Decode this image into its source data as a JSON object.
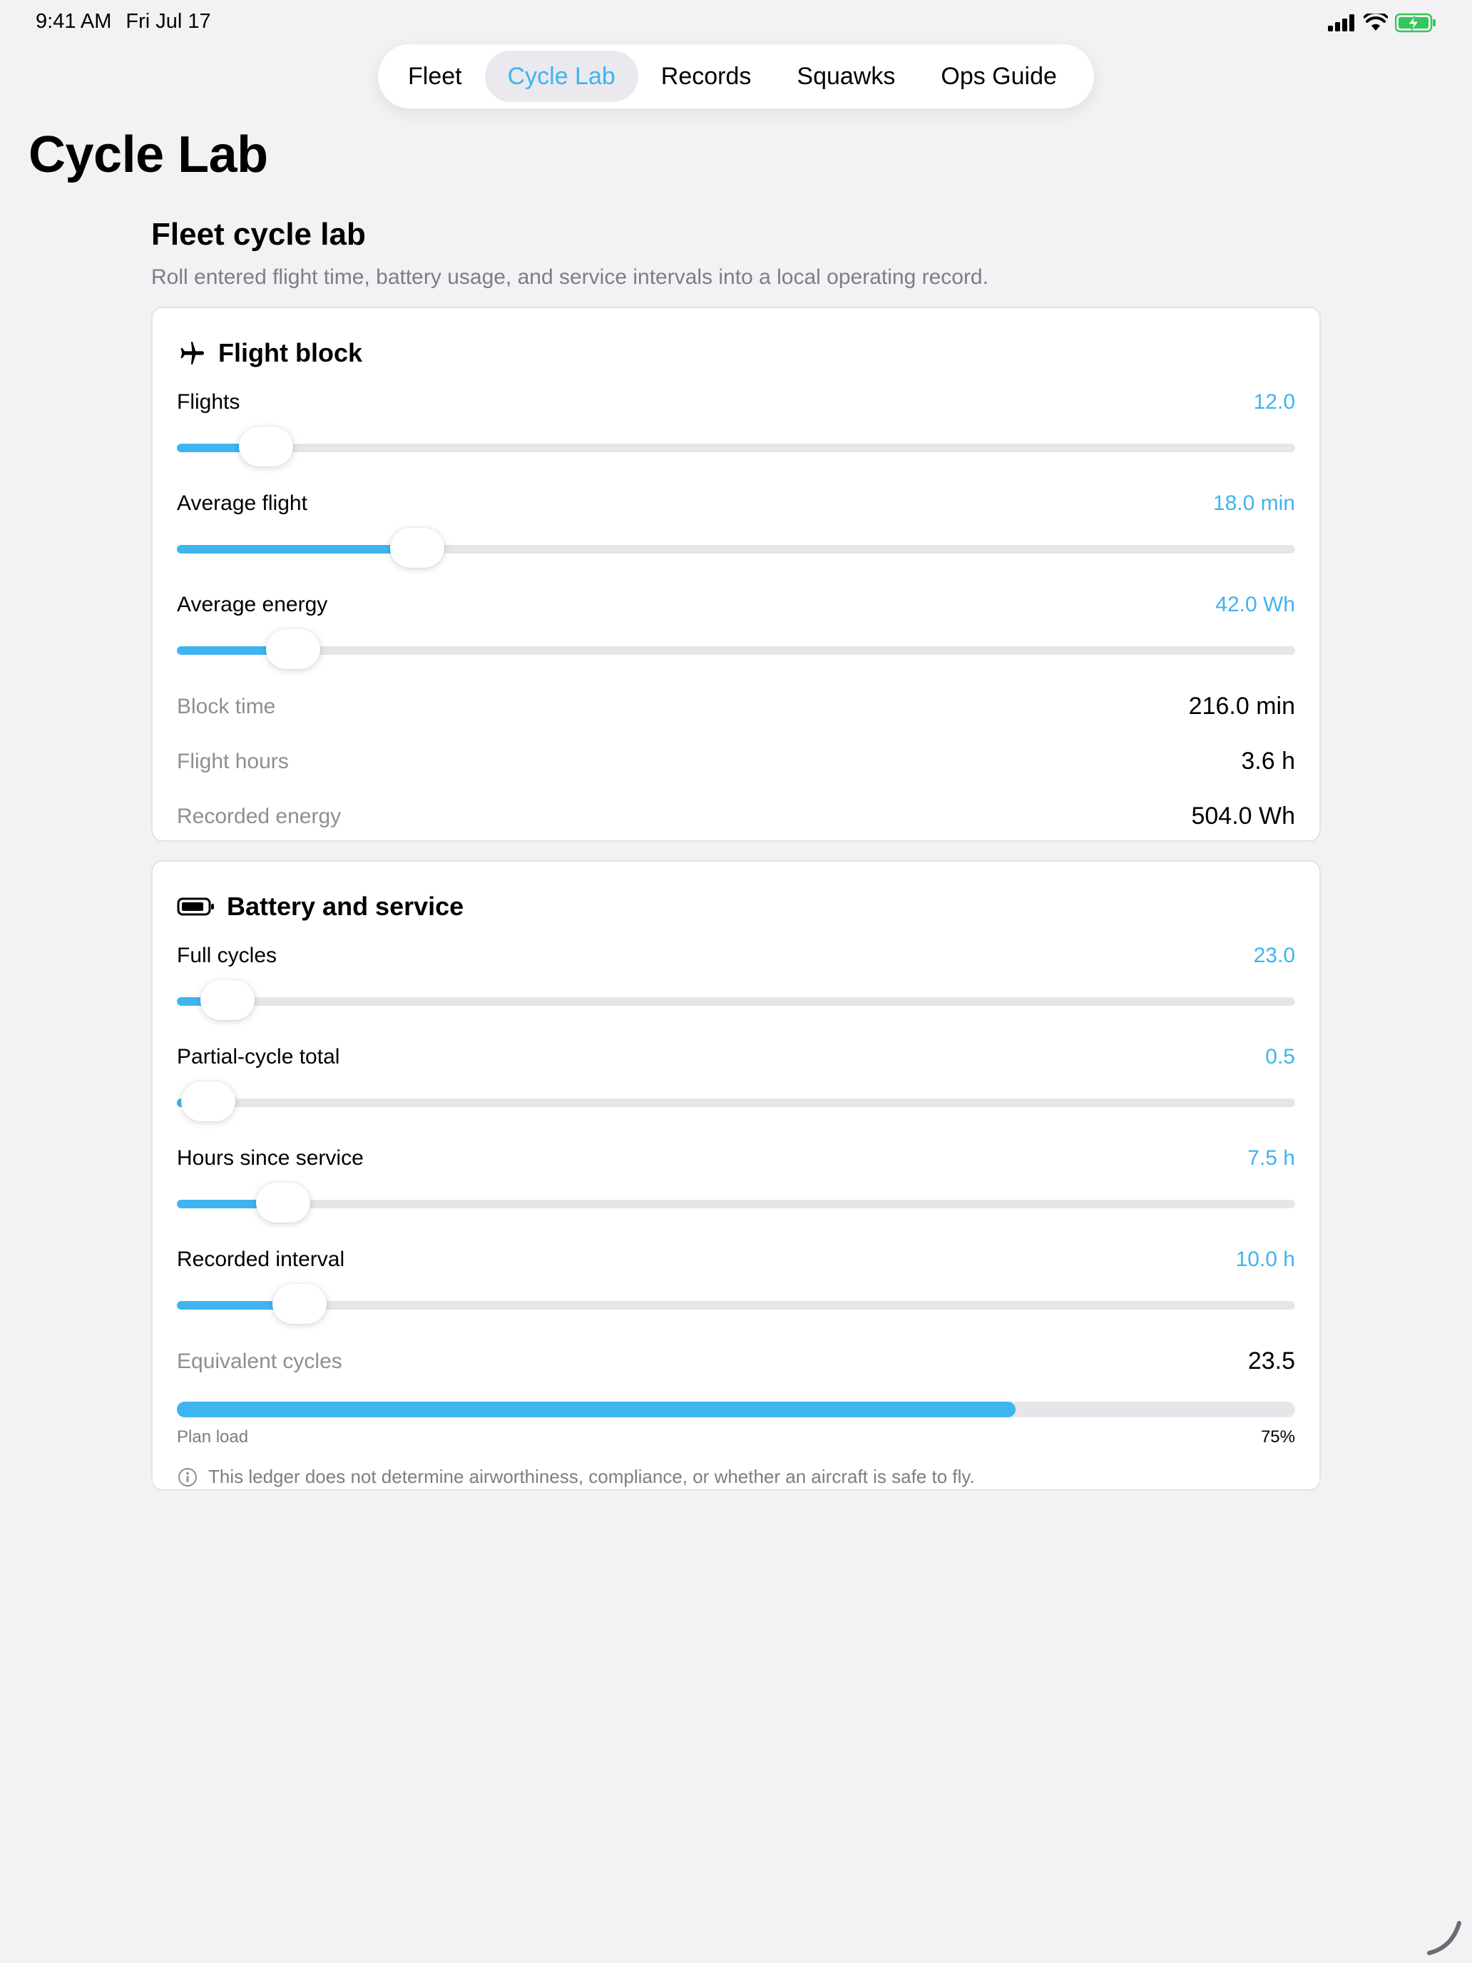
{
  "status": {
    "time": "9:41 AM",
    "date": "Fri Jul 17"
  },
  "tabs": [
    {
      "label": "Fleet",
      "active": false
    },
    {
      "label": "Cycle Lab",
      "active": true
    },
    {
      "label": "Records",
      "active": false
    },
    {
      "label": "Squawks",
      "active": false
    },
    {
      "label": "Ops Guide",
      "active": false
    }
  ],
  "page_title": "Cycle Lab",
  "section": {
    "title": "Fleet cycle lab",
    "subtitle": "Roll entered flight time, battery usage, and service intervals into a local operating record."
  },
  "flight_block": {
    "title": "Flight block",
    "icon": "airplane-icon",
    "sliders": [
      {
        "label": "Flights",
        "value": "12.0",
        "fraction": 0.08
      },
      {
        "label": "Average flight",
        "value": "18.0 min",
        "fraction": 0.215
      },
      {
        "label": "Average energy",
        "value": "42.0 Wh",
        "fraction": 0.104
      }
    ],
    "stats": [
      {
        "label": "Block time",
        "value": "216.0 min"
      },
      {
        "label": "Flight hours",
        "value": "3.6 h"
      },
      {
        "label": "Recorded energy",
        "value": "504.0 Wh"
      }
    ]
  },
  "battery_service": {
    "title": "Battery and service",
    "icon": "battery-icon",
    "sliders": [
      {
        "label": "Full cycles",
        "value": "23.0",
        "fraction": 0.045
      },
      {
        "label": "Partial-cycle total",
        "value": "0.5",
        "fraction": 0.028
      },
      {
        "label": "Hours since service",
        "value": "7.5 h",
        "fraction": 0.095
      },
      {
        "label": "Recorded interval",
        "value": "10.0 h",
        "fraction": 0.11
      }
    ],
    "equivalent": {
      "label": "Equivalent cycles",
      "value": "23.5"
    },
    "plan_load": {
      "caption": "Plan load",
      "percent_label": "75%",
      "percent": 75
    },
    "disclaimer": "This ledger does not determine airworthiness, compliance, or whether an aircraft is safe to fly."
  },
  "colors": {
    "accent": "#3fb4f0",
    "background": "#f2f2f5",
    "battery_green": "#34c759"
  }
}
